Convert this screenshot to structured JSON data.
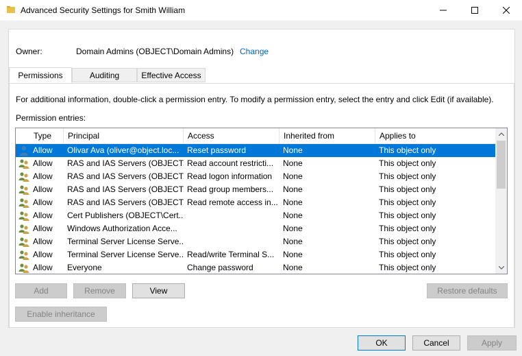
{
  "window": {
    "title": "Advanced Security Settings for Smith William",
    "minimize": "—",
    "maximize": "☐",
    "close": "✕"
  },
  "owner": {
    "label": "Owner:",
    "value": "Domain Admins (OBJECT\\Domain Admins)",
    "change": "Change"
  },
  "tabs": [
    {
      "label": "Permissions"
    },
    {
      "label": "Auditing"
    },
    {
      "label": "Effective Access"
    }
  ],
  "info_text": "For additional information, double-click a permission entry. To modify a permission entry, select the entry and click Edit (if available).",
  "entries_label": "Permission entries:",
  "columns": [
    "Type",
    "Principal",
    "Access",
    "Inherited from",
    "Applies to"
  ],
  "entries": [
    {
      "type": "Allow",
      "principal": "Olivar Ava (oliver@object.loc...",
      "access": "Reset password",
      "inherited": "None",
      "applies": "This object only",
      "icon": "single-user-icon",
      "selected": true
    },
    {
      "type": "Allow",
      "principal": "RAS and IAS Servers (OBJECT...",
      "access": "Read account restricti...",
      "inherited": "None",
      "applies": "This object only",
      "icon": "group-icon"
    },
    {
      "type": "Allow",
      "principal": "RAS and IAS Servers (OBJECT...",
      "access": "Read logon information",
      "inherited": "None",
      "applies": "This object only",
      "icon": "group-icon"
    },
    {
      "type": "Allow",
      "principal": "RAS and IAS Servers (OBJECT...",
      "access": "Read group members...",
      "inherited": "None",
      "applies": "This object only",
      "icon": "group-icon"
    },
    {
      "type": "Allow",
      "principal": "RAS and IAS Servers (OBJECT...",
      "access": "Read remote access in...",
      "inherited": "None",
      "applies": "This object only",
      "icon": "group-icon"
    },
    {
      "type": "Allow",
      "principal": "Cert Publishers (OBJECT\\Cert...",
      "access": "",
      "inherited": "None",
      "applies": "This object only",
      "icon": "group-icon"
    },
    {
      "type": "Allow",
      "principal": "Windows Authorization Acce...",
      "access": "",
      "inherited": "None",
      "applies": "This object only",
      "icon": "group-icon"
    },
    {
      "type": "Allow",
      "principal": "Terminal Server License Serve...",
      "access": "",
      "inherited": "None",
      "applies": "This object only",
      "icon": "group-icon"
    },
    {
      "type": "Allow",
      "principal": "Terminal Server License Serve...",
      "access": "Read/write Terminal S...",
      "inherited": "None",
      "applies": "This object only",
      "icon": "group-icon"
    },
    {
      "type": "Allow",
      "principal": "Everyone",
      "access": "Change password",
      "inherited": "None",
      "applies": "This object only",
      "icon": "group-icon"
    }
  ],
  "buttons": {
    "add": "Add",
    "remove": "Remove",
    "view": "View",
    "restore": "Restore defaults",
    "enable_inheritance": "Enable inheritance",
    "ok": "OK",
    "cancel": "Cancel",
    "apply": "Apply"
  },
  "colors": {
    "selection": "#0078d7",
    "link": "#0066cc"
  }
}
